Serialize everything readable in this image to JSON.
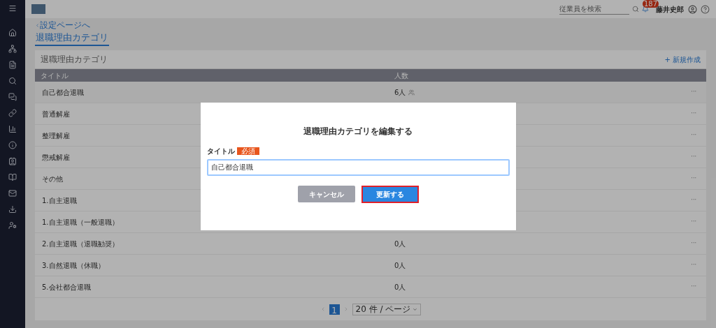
{
  "header": {
    "search": {
      "placeholder": "従業員を検索"
    },
    "notification_count": "187",
    "user_name": "藤井史郎"
  },
  "breadcrumb": "設定ページへ",
  "tabs": [
    {
      "label": "退職理由カテゴリ",
      "selected": true
    }
  ],
  "card": {
    "title": "退職理由カテゴリ",
    "new_button": "+ 新規作成",
    "table": {
      "columns": [
        "タイトル",
        "人数"
      ],
      "rows": [
        {
          "title": "自己都合退職",
          "count": "6人",
          "menu": "···"
        },
        {
          "title": "普通解雇",
          "menu": "···"
        },
        {
          "title": "整理解雇",
          "menu": "···"
        },
        {
          "title": "懲戒解雇",
          "menu": "···"
        },
        {
          "title": "その他",
          "menu": "···"
        },
        {
          "title": "1.自主退職",
          "menu": "···"
        },
        {
          "title": "1.自主退職（一般退職）",
          "menu": "···"
        },
        {
          "title": "2.自主退職（退職勧奨）",
          "count": "0人",
          "menu": "···"
        },
        {
          "title": "3.自然退職（休職）",
          "count": "0人",
          "menu": "···"
        },
        {
          "title": "5.会社都合退職",
          "count": "0人",
          "menu": "···"
        }
      ]
    },
    "pagination": {
      "pages": [
        {
          "label": "1",
          "selected": true
        }
      ],
      "page_size": "20 件 / ページ"
    }
  },
  "dialog": {
    "title": "退職理由カテゴリを編集する",
    "field_label": "タイトル",
    "required_badge": "必須",
    "value": "自己都合退職",
    "cancel": "キャンセル",
    "submit": "更新する"
  }
}
